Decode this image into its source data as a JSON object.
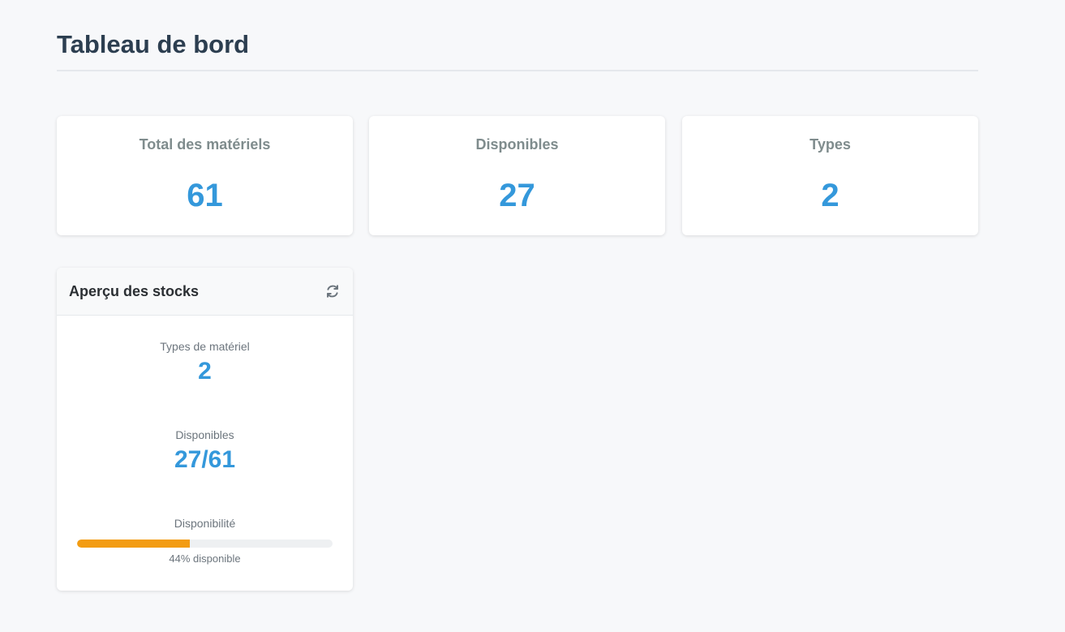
{
  "header": {
    "title": "Tableau de bord"
  },
  "stats": [
    {
      "label": "Total des matériels",
      "value": "61"
    },
    {
      "label": "Disponibles",
      "value": "27"
    },
    {
      "label": "Types",
      "value": "2"
    }
  ],
  "stock_panel": {
    "title": "Aperçu des stocks",
    "refresh_icon": "refresh-icon",
    "types": {
      "label": "Types de matériel",
      "value": "2"
    },
    "available": {
      "label": "Disponibles",
      "value": "27/61"
    },
    "availability": {
      "label": "Disponibilité",
      "percent": 44,
      "caption": "44% disponible"
    }
  },
  "colors": {
    "accent": "#3498db",
    "progress": "#f39c12",
    "title": "#2c3e50"
  }
}
